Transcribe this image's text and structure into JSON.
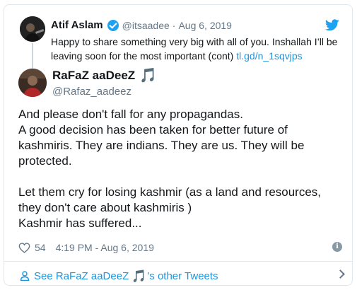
{
  "parent_tweet": {
    "name": "Atif Aslam",
    "handle": "@itsaadee",
    "separator": "·",
    "date": "Aug 6, 2019",
    "text": "Happy to share something very big with all of you. Inshallah I’ll be leaving soon for the most important (cont) ",
    "link": "tl.gd/n_1sqvjps"
  },
  "main_tweet": {
    "name": "RaFaZ aaDeeZ",
    "handle": "@Rafaz_aadeez",
    "name_emoji": "🎵",
    "text": "And please don't fall for any propagandas.\nA good decision has been taken for better future of kashmiris. They are indians. They are us. They will be protected.\n\nLet them cry for losing kashmir (as a land and resources, they don't care about kashmiris )\nKashmir has suffered...",
    "likes": "54",
    "time": "4:19 PM - Aug 6, 2019"
  },
  "footer": {
    "label_prefix": "See RaFaZ aaDeeZ ",
    "emoji": "🎵",
    "label_suffix": "'s other Tweets"
  },
  "colors": {
    "accent": "#1da1f2",
    "link": "#1b95e0",
    "muted": "#657786",
    "border": "#e1e8ed"
  },
  "icons": {
    "verified": "verified-badge-icon",
    "bird": "twitter-bird-icon",
    "heart": "heart-icon",
    "info": "info-icon",
    "person": "person-icon",
    "chevron": "chevron-right-icon"
  }
}
